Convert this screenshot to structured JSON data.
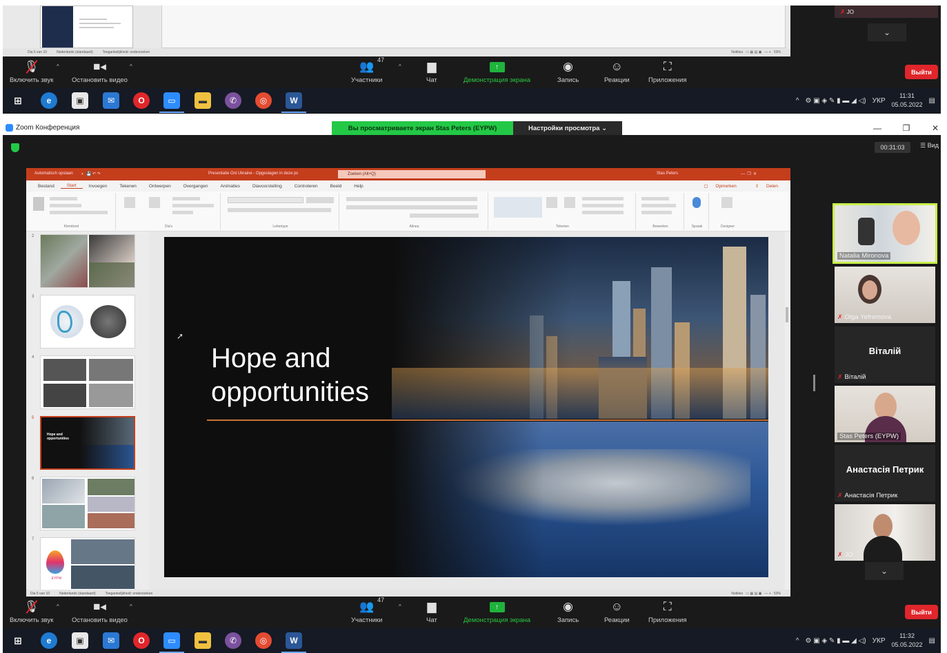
{
  "top_strip": {
    "ppt_status": {
      "slide": "Dia 5 van 10",
      "lang": "Nederlands (standaard)",
      "access": "Toegankelijkheid: onderzoeken",
      "notes": "Notities",
      "zoom": "53%"
    },
    "participant": {
      "name": "JO"
    }
  },
  "toolbar": {
    "mute_label": "Включить звук",
    "video_label": "Остановить видео",
    "participants_label": "Участники",
    "participants_count": "47",
    "chat_label": "Чат",
    "share_label": "Демонстрация экрана",
    "record_label": "Запись",
    "reactions_label": "Реакции",
    "apps_label": "Приложения",
    "leave_label": "Выйти"
  },
  "taskbar_top": {
    "lang": "УКР",
    "time": "11:31",
    "date": "05.05.2022"
  },
  "taskbar_bottom": {
    "lang": "УКР",
    "time": "11:32",
    "date": "05.05.2022"
  },
  "window": {
    "title": "Zoom Конференция",
    "share_banner": "Вы просматриваете экран Stas Peters (EYPW)",
    "view_options": "Настройки просмотра",
    "timer": "00:31:03",
    "view_button": "Вид"
  },
  "ppt": {
    "autosave": "Automatisch opslaan",
    "file": "Presentatie Oni Ukraine - Opgeslagen in deze pc",
    "search": "Zoeken (Alt+Q)",
    "user": "Stas Peters",
    "menu": [
      "Bestand",
      "Start",
      "Invoegen",
      "Tekenen",
      "Ontwerpen",
      "Overgangen",
      "Animaties",
      "Diavoorstelling",
      "Controleren",
      "Beeld",
      "Help"
    ],
    "comments": "Opmerken",
    "share": "Delen",
    "groups": [
      "Klembord",
      "Dia's",
      "Lettertype",
      "Alinea",
      "Tekenen",
      "Bewerken",
      "Spraak",
      "Designer"
    ],
    "thumb_numbers": [
      "2",
      "3",
      "4",
      "5",
      "6",
      "7"
    ],
    "selected_thumb_text": "Hope and opportunities",
    "eypw_label": "EYPW",
    "status": {
      "slide": "Dia 5 van 10",
      "lang": "Nederlands (standaard)",
      "access": "Toegankelijkheid: onderzoeken",
      "notes": "Notities",
      "zoom": "53%"
    }
  },
  "slide": {
    "title_line1": "Hope and",
    "title_line2": "opportunities"
  },
  "gallery": [
    {
      "name": "Natalia Mironova",
      "type": "video",
      "speaking": true
    },
    {
      "name": "Olga Yefremova",
      "type": "video",
      "muted": true
    },
    {
      "name": "Віталій",
      "type": "name",
      "label": "Віталій",
      "muted": true
    },
    {
      "name": "Stas Peters (EYPW)",
      "type": "video"
    },
    {
      "name": "Анастасія Петрик",
      "type": "name",
      "label": "Анастасія Петрик",
      "muted": true
    },
    {
      "name": "JO",
      "type": "video",
      "muted": true
    }
  ]
}
